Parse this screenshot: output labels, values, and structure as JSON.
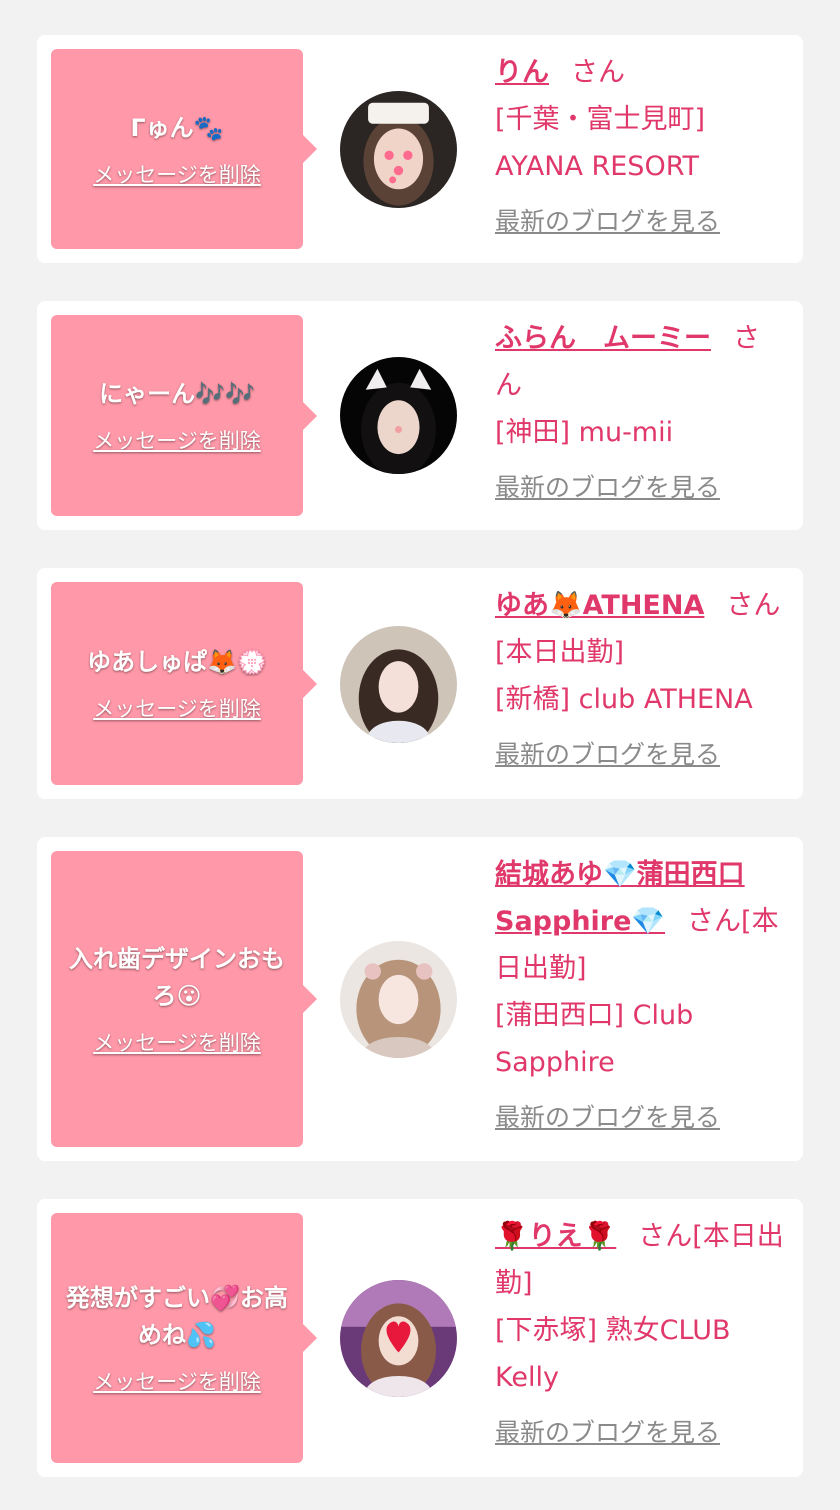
{
  "delete_label": "メッセージを削除",
  "blog_label": "最新のブログを見る",
  "honorific": "さん",
  "colors": {
    "bubble": "#ff98a8",
    "accent": "#e0386a",
    "link_gray": "#8a8a8a",
    "background": "#f2f2f2"
  },
  "messages": [
    {
      "message": "ᒥゅん🐾",
      "name": "りん",
      "status": "",
      "shop": "[千葉・富士見町] AYANA RESORT"
    },
    {
      "message": "にゃーん🎶🎶",
      "name": "ふらん　ムーミー",
      "status": "",
      "shop": "[神田] mu-mii"
    },
    {
      "message": "ゆあしゅぱ🦊💮",
      "name": "ゆあ🦊ATHENA",
      "status": "[本日出勤]",
      "shop": "[新橋] club ATHENA"
    },
    {
      "message": "入れ歯デザインおもろ😮",
      "name": "結城あゆ💎蒲田西口Sapphire💎",
      "status": "[本日出勤]",
      "shop": "[蒲田西口] Club Sapphire"
    },
    {
      "message": "発想がすごい💞お高めね💦",
      "name": "🌹りえ🌹",
      "status": "[本日出勤]",
      "shop": "[下赤塚] 熟女CLUB Kelly"
    }
  ]
}
